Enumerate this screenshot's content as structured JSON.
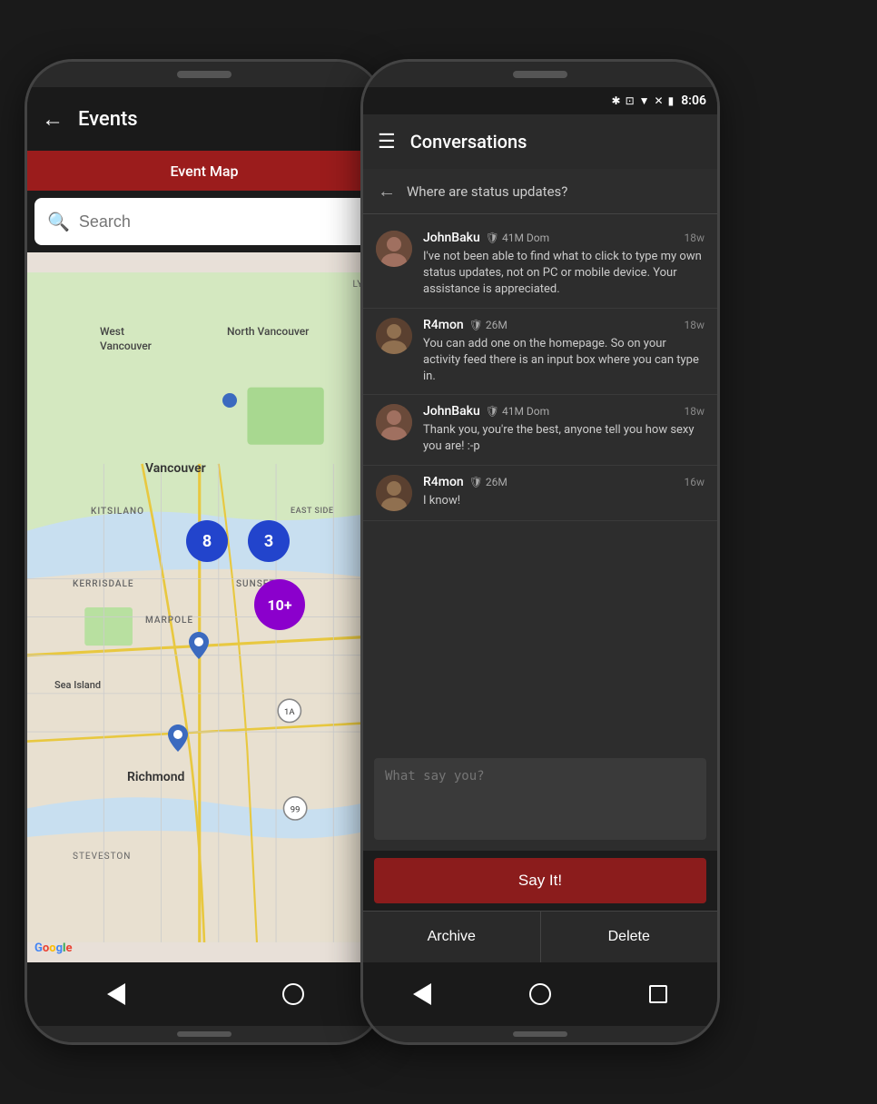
{
  "scene": {
    "bg": "#1a1a1a"
  },
  "phone_left": {
    "header": {
      "back_label": "←",
      "title": "Events"
    },
    "tab": {
      "label": "Event Map"
    },
    "search": {
      "placeholder": "Search"
    },
    "map": {
      "label": "North Vancouver",
      "west_vancouver": "West Vancouver",
      "north_vancouver": "North Vancouver",
      "vancouver": "Vancouver",
      "kitsilano": "KITSILANO",
      "kerrisdale": "KERRISDALE",
      "marpole": "MARPOLE",
      "sunset": "SUNSET",
      "east_side": "EAST SIDE",
      "sea_island": "Sea Island",
      "richmond": "Richmond",
      "steveston": "STEVESTON",
      "lynn": "LYNN",
      "google_label": "Google",
      "marker_8": "8",
      "marker_3": "3",
      "marker_10plus": "10+"
    },
    "nav": {
      "back_label": "◀",
      "home_label": "○"
    }
  },
  "phone_right": {
    "status_bar": {
      "time": "8:06",
      "icons": [
        "bluetooth",
        "vibrate",
        "wifi",
        "signal",
        "battery"
      ]
    },
    "header": {
      "menu_label": "☰",
      "title": "Conversations"
    },
    "subheader": {
      "back_label": "←",
      "text": "Where are status updates?"
    },
    "messages": [
      {
        "name": "JohnBaku",
        "badge": "🛡 41M Dom",
        "time": "18w",
        "text": "I've not been able to find what to click to type my own status updates, not on PC or mobile device. Your assistance is appreciated.",
        "avatar_color": "#7a5a4a"
      },
      {
        "name": "R4mon",
        "badge": "🛡 26M",
        "time": "18w",
        "text": "You can add one on the homepage. So on your activity feed there is an input box where you can type in.",
        "avatar_color": "#7a5a4a"
      },
      {
        "name": "JohnBaku",
        "badge": "🛡 41M Dom",
        "time": "18w",
        "text": "Thank you, you're the best, anyone tell you how sexy you are! :-p",
        "avatar_color": "#7a5a4a"
      },
      {
        "name": "R4mon",
        "badge": "🛡 26M",
        "time": "16w",
        "text": "I know!",
        "avatar_color": "#7a5a4a"
      }
    ],
    "reply": {
      "placeholder": "What say you?"
    },
    "say_it_btn": "Say It!",
    "archive_btn": "Archive",
    "delete_btn": "Delete",
    "nav": {
      "back_label": "◀",
      "home_label": "○",
      "square_label": "□"
    }
  }
}
